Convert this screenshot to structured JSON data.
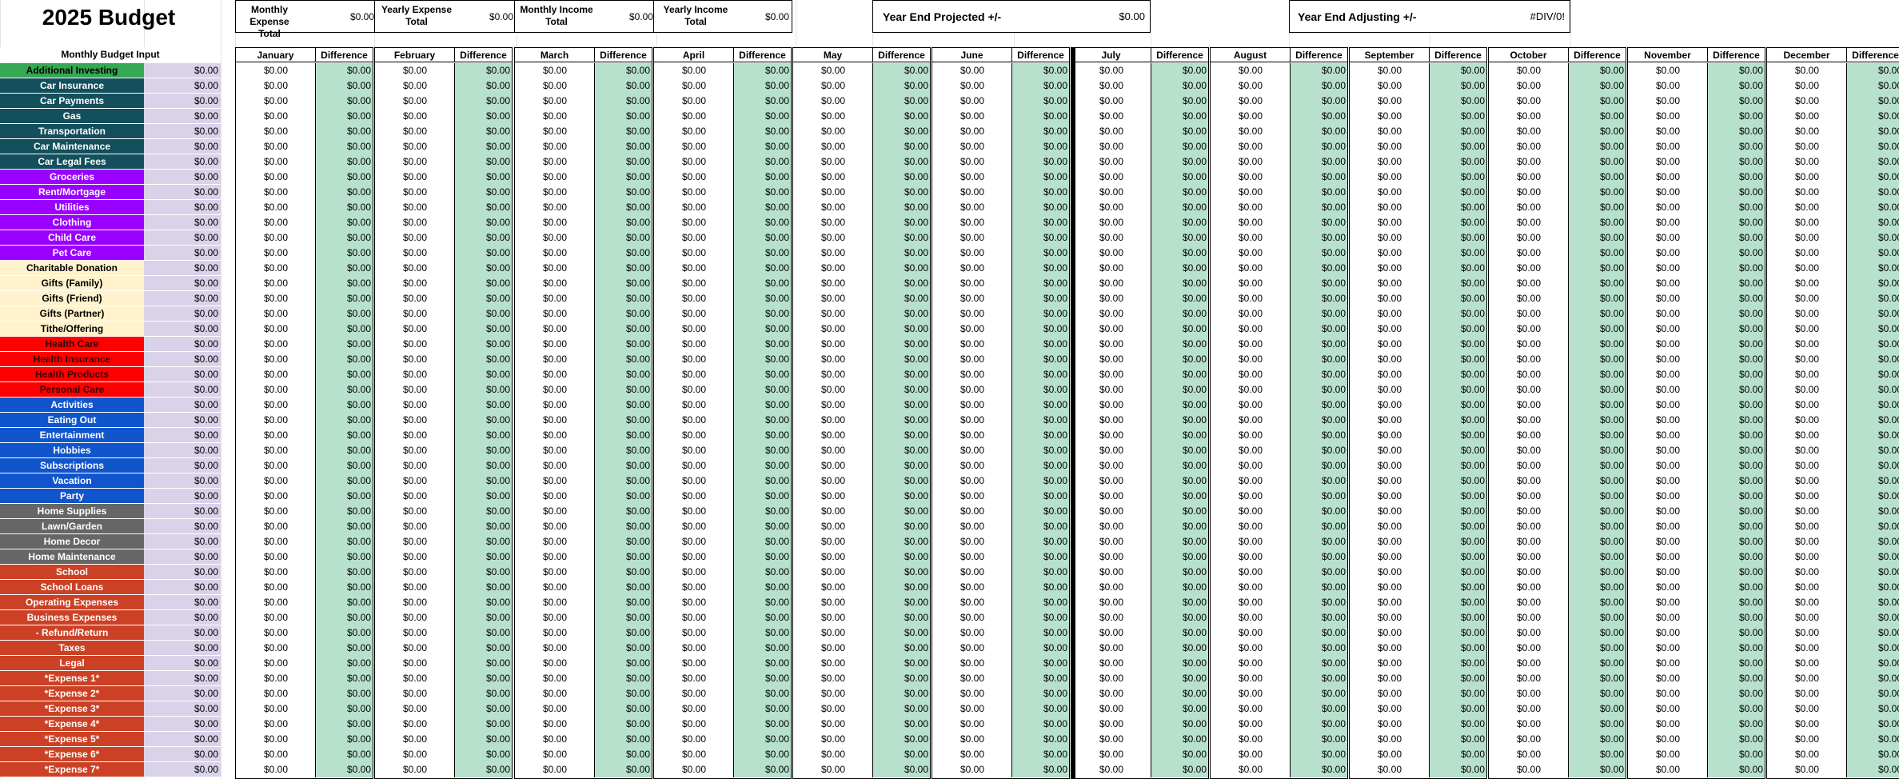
{
  "title": "2025 Budget",
  "summary": {
    "monthly_expense_label": "Monthly Expense Total",
    "monthly_expense_value": "$0.00",
    "yearly_expense_label": "Yearly Expense Total",
    "yearly_expense_value": "$0.00",
    "monthly_income_label": "Monthly Income Total",
    "monthly_income_value": "$0.00",
    "yearly_income_label": "Yearly Income Total",
    "yearly_income_value": "$0.00",
    "projected_label": "Year End Projected +/-",
    "projected_value": "$0.00",
    "adjusting_label": "Year End Adjusting +/-",
    "adjusting_value": "#DIV/0!"
  },
  "input_header": "Monthly Budget Input",
  "difference_label": "Difference",
  "zero_value": "$0.00",
  "months": [
    "January",
    "February",
    "March",
    "April",
    "May",
    "June",
    "July",
    "August",
    "September",
    "October",
    "November",
    "December"
  ],
  "categories": [
    {
      "label": "Additional Investing",
      "color": "#34a853",
      "text": "dark"
    },
    {
      "label": "Car Insurance",
      "color": "#134f5c",
      "text": "light"
    },
    {
      "label": "Car Payments",
      "color": "#134f5c",
      "text": "light"
    },
    {
      "label": "Gas",
      "color": "#134f5c",
      "text": "light"
    },
    {
      "label": "Transportation",
      "color": "#134f5c",
      "text": "light"
    },
    {
      "label": "Car Maintenance",
      "color": "#134f5c",
      "text": "light"
    },
    {
      "label": "Car Legal Fees",
      "color": "#134f5c",
      "text": "light"
    },
    {
      "label": "Groceries",
      "color": "#9900ff",
      "text": "light"
    },
    {
      "label": "Rent/Mortgage",
      "color": "#9900ff",
      "text": "light"
    },
    {
      "label": "Utilities",
      "color": "#9900ff",
      "text": "light"
    },
    {
      "label": "Clothing",
      "color": "#9900ff",
      "text": "light"
    },
    {
      "label": "Child Care",
      "color": "#9900ff",
      "text": "light"
    },
    {
      "label": "Pet Care",
      "color": "#9900ff",
      "text": "light"
    },
    {
      "label": "Charitable Donation",
      "color": "#fff2cc",
      "text": "dark"
    },
    {
      "label": "Gifts (Family)",
      "color": "#fff2cc",
      "text": "dark"
    },
    {
      "label": "Gifts (Friend)",
      "color": "#fff2cc",
      "text": "dark"
    },
    {
      "label": "Gifts (Partner)",
      "color": "#fff2cc",
      "text": "dark"
    },
    {
      "label": "Tithe/Offering",
      "color": "#fff2cc",
      "text": "dark"
    },
    {
      "label": "Health Care",
      "color": "#ff0000",
      "text": "red"
    },
    {
      "label": "Health Insurance",
      "color": "#ff0000",
      "text": "red"
    },
    {
      "label": "Health Products",
      "color": "#ff0000",
      "text": "red"
    },
    {
      "label": "Personal Care",
      "color": "#ff0000",
      "text": "red"
    },
    {
      "label": "Activities",
      "color": "#1155cc",
      "text": "light"
    },
    {
      "label": "Eating Out",
      "color": "#1155cc",
      "text": "light"
    },
    {
      "label": "Entertainment",
      "color": "#1155cc",
      "text": "light"
    },
    {
      "label": "Hobbies",
      "color": "#1155cc",
      "text": "light"
    },
    {
      "label": "Subscriptions",
      "color": "#1155cc",
      "text": "light"
    },
    {
      "label": "Vacation",
      "color": "#1155cc",
      "text": "light"
    },
    {
      "label": "Party",
      "color": "#1155cc",
      "text": "light"
    },
    {
      "label": "Home Supplies",
      "color": "#666666",
      "text": "light"
    },
    {
      "label": "Lawn/Garden",
      "color": "#666666",
      "text": "light"
    },
    {
      "label": "Home Decor",
      "color": "#666666",
      "text": "light"
    },
    {
      "label": "Home Maintenance",
      "color": "#666666",
      "text": "light"
    },
    {
      "label": "School",
      "color": "#cc4125",
      "text": "light"
    },
    {
      "label": "School Loans",
      "color": "#cc4125",
      "text": "light"
    },
    {
      "label": "Operating Expenses",
      "color": "#cc4125",
      "text": "light"
    },
    {
      "label": "Business Expenses",
      "color": "#cc4125",
      "text": "light"
    },
    {
      "label": "- Refund/Return",
      "color": "#cc4125",
      "text": "light"
    },
    {
      "label": "Taxes",
      "color": "#cc4125",
      "text": "light"
    },
    {
      "label": "Legal",
      "color": "#cc4125",
      "text": "light"
    },
    {
      "label": "*Expense 1*",
      "color": "#cc4125",
      "text": "light"
    },
    {
      "label": "*Expense 2*",
      "color": "#cc4125",
      "text": "light"
    },
    {
      "label": "*Expense 3*",
      "color": "#cc4125",
      "text": "light"
    },
    {
      "label": "*Expense 4*",
      "color": "#cc4125",
      "text": "light"
    },
    {
      "label": "*Expense 5*",
      "color": "#cc4125",
      "text": "light"
    },
    {
      "label": "*Expense 6*",
      "color": "#cc4125",
      "text": "light"
    },
    {
      "label": "*Expense 7*",
      "color": "#cc4125",
      "text": "light"
    }
  ],
  "colors": {
    "input_fill": "#d9d2e9",
    "difference_fill": "#b7e1cd",
    "gridline": "#e3e3e3"
  }
}
